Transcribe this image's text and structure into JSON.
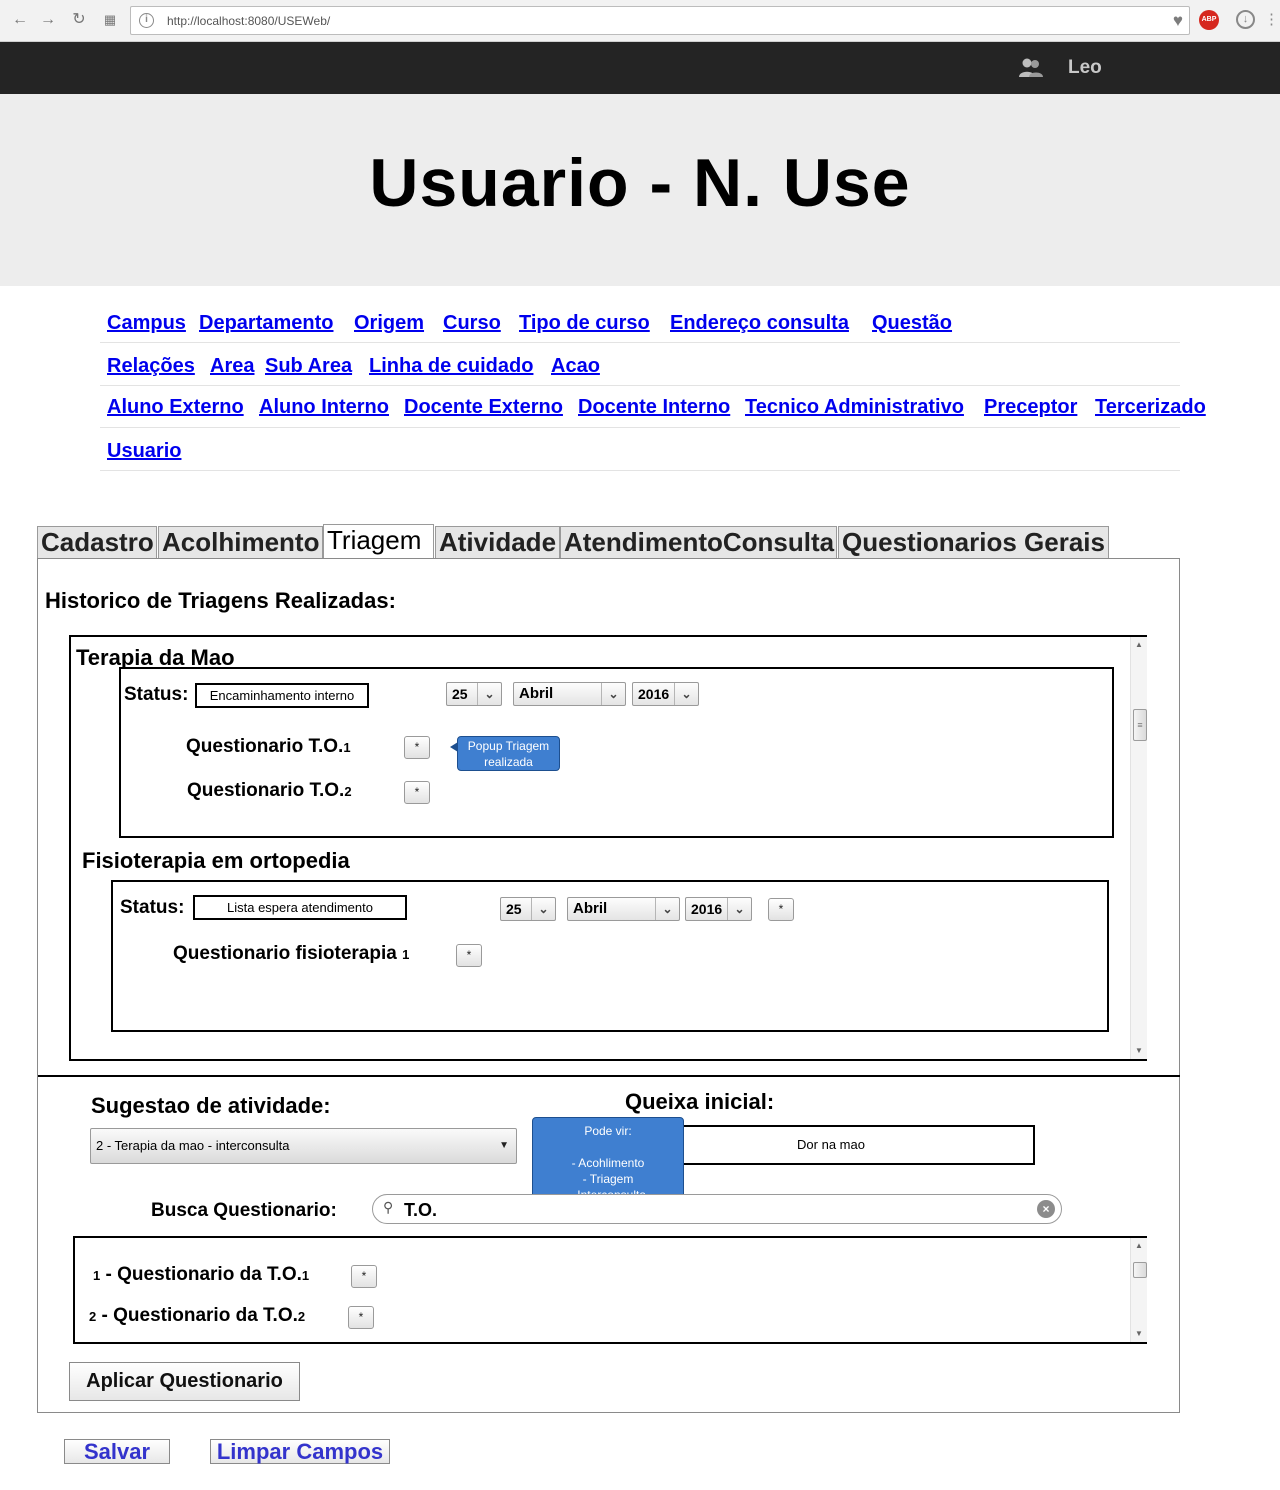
{
  "browser": {
    "url": "http://localhost:8080/USEWeb/"
  },
  "header": {
    "user_name": "Leo",
    "title": "Usuario - N. Use"
  },
  "menu": {
    "rows": [
      [
        "Campus",
        "Departamento",
        "Origem",
        "Curso",
        "Tipo de curso",
        "Endereço consulta",
        "Questão"
      ],
      [
        "Relações",
        "Area",
        "Sub Area",
        "Linha de cuidado",
        "Acao"
      ],
      [
        "Aluno Externo",
        "Aluno Interno",
        "Docente Externo",
        "Docente Interno",
        "Tecnico Administrativo",
        "Preceptor",
        "Tercerizado"
      ],
      [
        "Usuario"
      ]
    ]
  },
  "tabs": [
    "Cadastro",
    "Acolhimento",
    "Triagem",
    "Atividade",
    "AtendimentoConsulta",
    "Questionarios Gerais"
  ],
  "active_tab": "Triagem",
  "historico": {
    "heading": "Historico de Triagens Realizadas:",
    "sections": [
      {
        "title": "Terapia da Mao",
        "status_label": "Status:",
        "status_value": "Encaminhamento interno",
        "day": "25",
        "month": "Abril",
        "year": "2016",
        "questionarios": [
          {
            "label": "Questionario T.O.",
            "num": "1",
            "button": "*"
          },
          {
            "label": "Questionario T.O.",
            "num": "2",
            "button": "*"
          }
        ],
        "tooltip": "Popup Triagem\nrealizada"
      },
      {
        "title": "Fisioterapia em ortopedia",
        "status_label": "Status:",
        "status_value": "Lista espera atendimento",
        "day": "25",
        "month": "Abril",
        "year": "2016",
        "date_button": "*",
        "questionarios": [
          {
            "label": "Questionario fisioterapia",
            "num": "1",
            "button": "*"
          }
        ]
      }
    ]
  },
  "sugestao": {
    "label": "Sugestao de atividade:",
    "selected": "2 - Terapia da mao - interconsulta"
  },
  "queixa": {
    "label": "Queixa inicial:",
    "value": "Dor na mao"
  },
  "tooltip_pode_vir": "Pode vir:\n\n- Acohlimento\n- Triagem\n- Interconsulta",
  "busca": {
    "label": "Busca Questionario:",
    "value": "T.O."
  },
  "results": [
    {
      "num": "1",
      "label": "- Questionario da T.O.",
      "suffix": "1",
      "button": "*"
    },
    {
      "num": "2",
      "label": "- Questionario da T.O.",
      "suffix": "2",
      "button": "*"
    }
  ],
  "actions": {
    "aplicar": "Aplicar Questionario",
    "salvar": "Salvar",
    "limpar": "Limpar Campos"
  },
  "colors": {
    "topbar": "#242424",
    "hero_bg": "#ededed",
    "link": "#0000ee",
    "tooltip": "#3f7fd0",
    "bottom_buttons_text": "#3333cc"
  }
}
